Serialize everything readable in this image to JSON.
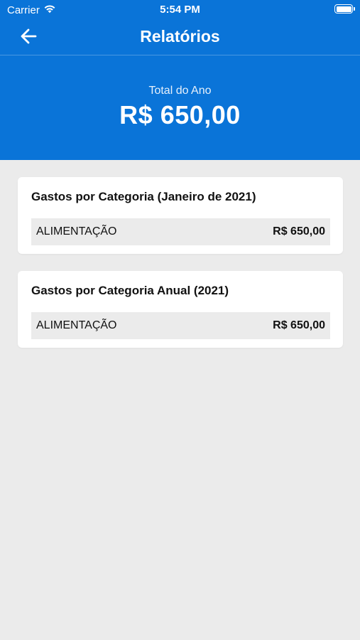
{
  "status_bar": {
    "carrier": "Carrier",
    "time": "5:54 PM"
  },
  "nav": {
    "title": "Relatórios"
  },
  "summary": {
    "label": "Total do Ano",
    "value": "R$ 650,00"
  },
  "cards": [
    {
      "title": "Gastos por Categoria (Janeiro de 2021)",
      "rows": [
        {
          "category": "ALIMENTAÇÃO",
          "amount": "R$ 650,00"
        }
      ]
    },
    {
      "title": "Gastos por Categoria Anual (2021)",
      "rows": [
        {
          "category": "ALIMENTAÇÃO",
          "amount": "R$ 650,00"
        }
      ]
    }
  ],
  "colors": {
    "primary": "#0a74d8",
    "background": "#ebebeb",
    "card": "#ffffff"
  }
}
